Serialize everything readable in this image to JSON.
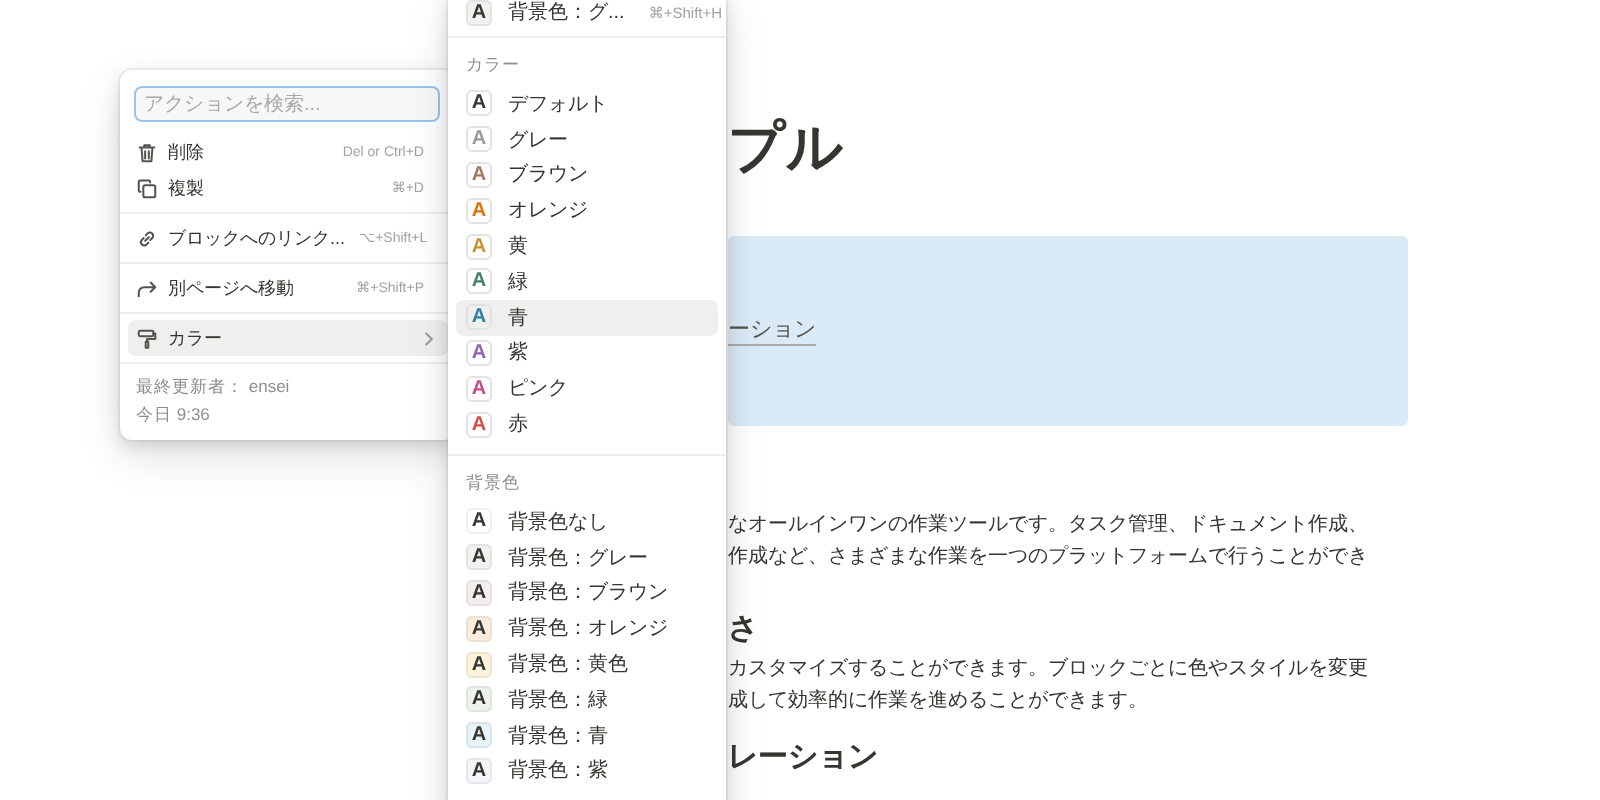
{
  "page": {
    "title": "プル",
    "callout": {
      "text": "ーション"
    },
    "blocks": [
      {
        "kind": "paragraph",
        "lines": [
          "なオールインワンの作業ツールです。タスク管理、ドキュメント作成、",
          "作成など、さまざまな作業を一つのプラットフォームで行うことができ"
        ]
      },
      {
        "kind": "heading",
        "text": "さ"
      },
      {
        "kind": "paragraph",
        "lines": [
          "カスタマイズすることができます。ブロックごとに色やスタイルを変更",
          "成して効率的に作業を進めることができます。"
        ]
      },
      {
        "kind": "heading",
        "text": "レーション"
      }
    ]
  },
  "action_menu": {
    "search": {
      "placeholder": "アクションを検索..."
    },
    "groups": [
      [
        {
          "label": "削除",
          "shortcut": "Del or Ctrl+D",
          "selected": false,
          "has_submenu": false
        },
        {
          "label": "複製",
          "shortcut": "⌘+D",
          "selected": false,
          "has_submenu": false
        }
      ],
      [
        {
          "label": "ブロックへのリンク...",
          "shortcut": "⌥+Shift+L",
          "selected": false,
          "has_submenu": false
        }
      ],
      [
        {
          "label": "別ページへ移動",
          "shortcut": "⌘+Shift+P",
          "selected": false,
          "has_submenu": false
        }
      ],
      [
        {
          "label": "カラー",
          "selected": true,
          "has_submenu": true
        }
      ]
    ],
    "footer": [
      "最終更新者： ensei",
      "今日 9:36"
    ]
  },
  "color_menu": {
    "top_item": {
      "glyph": "A",
      "label": "背景色：グ...",
      "shortcut": "⌘+Shift+H",
      "color": "#f1f1ef"
    },
    "sections": [
      {
        "title": "カラー",
        "kind": "text",
        "items": [
          {
            "glyph": "A",
            "label": "デフォルト",
            "color": "#37352f",
            "selected": false
          },
          {
            "glyph": "A",
            "label": "グレー",
            "color": "#9b9a97",
            "selected": false
          },
          {
            "glyph": "A",
            "label": "ブラウン",
            "color": "#a27763",
            "selected": false
          },
          {
            "glyph": "A",
            "label": "オレンジ",
            "color": "#d9730d",
            "selected": false
          },
          {
            "glyph": "A",
            "label": "黄",
            "color": "#cb912f",
            "selected": false
          },
          {
            "glyph": "A",
            "label": "緑",
            "color": "#448361",
            "selected": false
          },
          {
            "glyph": "A",
            "label": "青",
            "color": "#337ea9",
            "selected": true
          },
          {
            "glyph": "A",
            "label": "紫",
            "color": "#9065b0",
            "selected": false
          },
          {
            "glyph": "A",
            "label": "ピンク",
            "color": "#c14c8a",
            "selected": false
          },
          {
            "glyph": "A",
            "label": "赤",
            "color": "#d44c47",
            "selected": false
          }
        ]
      },
      {
        "title": "背景色",
        "kind": "background",
        "items": [
          {
            "glyph": "A",
            "label": "背景色なし",
            "color": "#ffffff",
            "selected": false
          },
          {
            "glyph": "A",
            "label": "背景色：グレー",
            "color": "#f1f1ef",
            "selected": false
          },
          {
            "glyph": "A",
            "label": "背景色：ブラウン",
            "color": "#f4eeee",
            "selected": false
          },
          {
            "glyph": "A",
            "label": "背景色：オレンジ",
            "color": "#fbecdd",
            "selected": false
          },
          {
            "glyph": "A",
            "label": "背景色：黄色",
            "color": "#fbf3db",
            "selected": false
          },
          {
            "glyph": "A",
            "label": "背景色：緑",
            "color": "#edf3ec",
            "selected": false
          },
          {
            "glyph": "A",
            "label": "背景色：青",
            "color": "#e7f3f8",
            "selected": false
          },
          {
            "glyph": "A",
            "label": "背景色：紫",
            "color": "#f6f3f9",
            "selected": false
          }
        ]
      }
    ]
  }
}
